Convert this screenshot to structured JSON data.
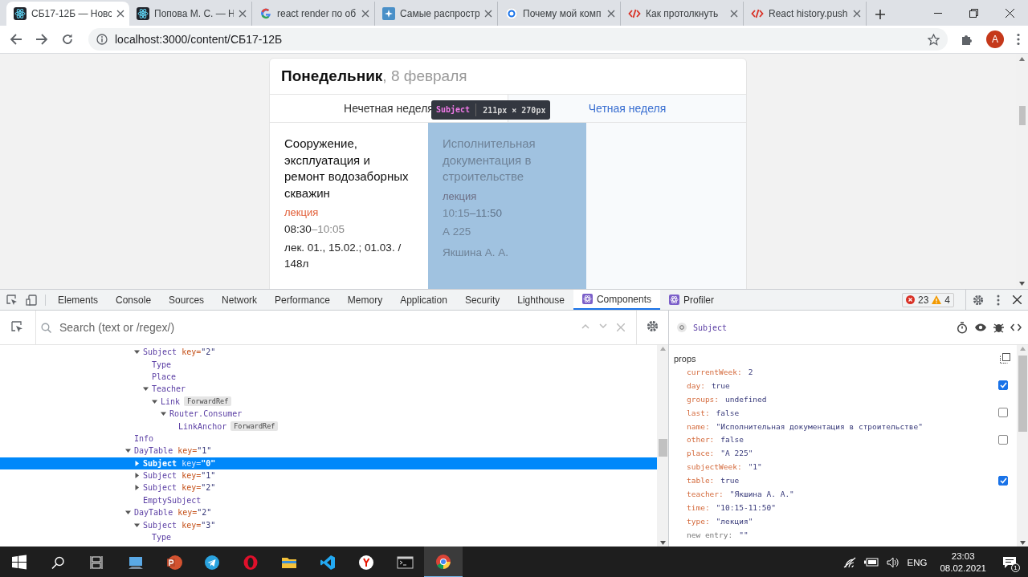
{
  "browser": {
    "tabs": [
      {
        "title": "СБ17-12Б — Новс",
        "kind": "react",
        "selected": true
      },
      {
        "title": "Попова М. С. — Н",
        "kind": "react",
        "selected": false
      },
      {
        "title": "react render по об",
        "kind": "google",
        "selected": false
      },
      {
        "title": "Самые распростр",
        "kind": "spark",
        "selected": false
      },
      {
        "title": "Почему мой комп",
        "kind": "ring",
        "selected": false
      },
      {
        "title": "Как протолкнуть",
        "kind": "code",
        "selected": false
      },
      {
        "title": "React history.push",
        "kind": "code",
        "selected": false
      }
    ],
    "address": "localhost:3000/content/СБ17-12Б",
    "profile": "A"
  },
  "page": {
    "day": "Понедельник",
    "date": ", 8 февраля",
    "weeks": [
      {
        "label": "Нечетная неделя",
        "selected": false
      },
      {
        "label": "Четная неделя",
        "selected": true
      }
    ],
    "subjects": [
      {
        "name": "Сооружение, эксплуатация и ремонт водозаборных скважин",
        "type": "лекция",
        "time_start": "08:30",
        "time_end": "–10:05",
        "details": [
          "лек. 01., 15.02.; 01.03. / 148л"
        ],
        "highlighted": false
      },
      {
        "name": "Исполнительная документация в строительстве",
        "type": "лекция",
        "time_start": "10:15",
        "time_end": "–11:50",
        "details": [
          "А 225",
          "Якшина А. А."
        ],
        "highlighted": true
      }
    ],
    "inspect_tooltip": {
      "component": "Subject",
      "size": "211px × 270px"
    }
  },
  "devtools": {
    "tabs": [
      {
        "label": "Elements",
        "selected": false,
        "react": false
      },
      {
        "label": "Console",
        "selected": false,
        "react": false
      },
      {
        "label": "Sources",
        "selected": false,
        "react": false
      },
      {
        "label": "Network",
        "selected": false,
        "react": false
      },
      {
        "label": "Performance",
        "selected": false,
        "react": false
      },
      {
        "label": "Memory",
        "selected": false,
        "react": false
      },
      {
        "label": "Application",
        "selected": false,
        "react": false
      },
      {
        "label": "Security",
        "selected": false,
        "react": false
      },
      {
        "label": "Lighthouse",
        "selected": false,
        "react": false
      },
      {
        "label": "Components",
        "selected": true,
        "react": true
      },
      {
        "label": "Profiler",
        "selected": false,
        "react": true
      }
    ],
    "errors": "23",
    "warnings": "4",
    "search": {
      "placeholder": "Search (text or /regex/)"
    },
    "tree": [
      {
        "children": [
          {
            "name": "Subject",
            "key_name": "key=",
            "key_value": "\"2\"",
            "expanded": true,
            "selected": false,
            "children": [
              {
                "name": "Type",
                "selected": false
              },
              {
                "name": "Place",
                "selected": false
              },
              {
                "name": "Teacher",
                "expanded": true,
                "selected": false,
                "children": [
                  {
                    "name": "Link",
                    "badge": "ForwardRef",
                    "expanded": true,
                    "selected": false,
                    "children": [
                      {
                        "name": "Router.Consumer",
                        "expanded": true,
                        "selected": false,
                        "children": [
                          {
                            "name": "LinkAnchor",
                            "badge": "ForwardRef",
                            "selected": false
                          }
                        ]
                      }
                    ]
                  }
                ]
              }
            ]
          }
        ]
      },
      {
        "name": "Info",
        "selected": false
      },
      {
        "name": "DayTable",
        "key_name": "key=",
        "key_value": "\"1\"",
        "expanded": true,
        "selected": false,
        "children": [
          {
            "name": "Subject",
            "key_name": "key=",
            "key_value": "\"0\"",
            "expanded": false,
            "selected": true
          },
          {
            "name": "Subject",
            "key_name": "key=",
            "key_value": "\"1\"",
            "expanded": false,
            "selected": false
          },
          {
            "name": "Subject",
            "key_name": "key=",
            "key_value": "\"2\"",
            "expanded": false,
            "selected": false
          },
          {
            "name": "EmptySubject",
            "selected": false
          }
        ]
      },
      {
        "name": "DayTable",
        "key_name": "key=",
        "key_value": "\"2\"",
        "expanded": true,
        "selected": false,
        "children": [
          {
            "name": "Subject",
            "key_name": "key=",
            "key_value": "\"3\"",
            "expanded": true,
            "selected": false,
            "children": [
              {
                "name": "Type",
                "selected": false
              }
            ]
          }
        ]
      }
    ],
    "selected_component": "Subject",
    "props_title": "props",
    "props": [
      {
        "name": "currentWeek:",
        "value": "2",
        "kind": "plain"
      },
      {
        "name": "day:",
        "value": "true",
        "kind": "bool",
        "checked": true
      },
      {
        "name": "groups:",
        "value": "undefined",
        "kind": "plain"
      },
      {
        "name": "last:",
        "value": "false",
        "kind": "bool",
        "checked": false
      },
      {
        "name": "name:",
        "value": "\"Исполнительная документация в строительстве\"",
        "kind": "plain"
      },
      {
        "name": "other:",
        "value": "false",
        "kind": "bool",
        "checked": false
      },
      {
        "name": "place:",
        "value": "\"А 225\"",
        "kind": "plain"
      },
      {
        "name": "subjectWeek:",
        "value": "\"1\"",
        "kind": "plain"
      },
      {
        "name": "table:",
        "value": "true",
        "kind": "bool",
        "checked": true
      },
      {
        "name": "teacher:",
        "value": "\"Якшина А. А.\"",
        "kind": "plain"
      },
      {
        "name": "time:",
        "value": "\"10:15-11:50\"",
        "kind": "plain"
      },
      {
        "name": "type:",
        "value": "\"лекция\"",
        "kind": "plain"
      },
      {
        "name": "new entry:",
        "value": "\"\"",
        "kind": "new"
      }
    ]
  },
  "taskbar": {
    "apps": [
      {
        "kind": "computer",
        "active": false
      },
      {
        "kind": "powerpoint",
        "active": false
      },
      {
        "kind": "telegram",
        "active": false
      },
      {
        "kind": "opera",
        "active": false
      },
      {
        "kind": "explorer",
        "active": false
      },
      {
        "kind": "vscode",
        "active": false
      },
      {
        "kind": "yandex",
        "active": false
      },
      {
        "kind": "terminal",
        "active": false
      },
      {
        "kind": "chrome",
        "active": true
      }
    ],
    "language": "ENG",
    "time": "23:03",
    "date": "08.02.2021",
    "notifications": "1"
  }
}
